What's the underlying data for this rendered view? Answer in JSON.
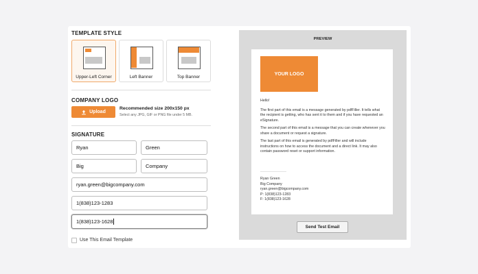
{
  "template_style": {
    "title": "TEMPLATE STYLE",
    "options": [
      {
        "label": "Upper-Left Corner",
        "selected": true
      },
      {
        "label": "Left Banner",
        "selected": false
      },
      {
        "label": "Top Banner",
        "selected": false
      }
    ]
  },
  "company_logo": {
    "title": "COMPANY LOGO",
    "upload_label": "Upload",
    "size_text": "Recommended size 200x150 px",
    "hint_text": "Select any JPG, GIF or PNG file under 5 MB."
  },
  "signature": {
    "title": "SIGNATURE",
    "first_name": "Ryan",
    "last_name": "Green",
    "title_field": "Big",
    "company": "Company",
    "email": "ryan.green@bigcompany.com",
    "phone": "1(838)123-1283",
    "fax": "1(838)123-1628"
  },
  "use_template": {
    "label": "Use This Email Template",
    "checked": false
  },
  "preview": {
    "title": "PREVIEW",
    "logo_text": "YOUR LOGO",
    "greeting": "Hello!",
    "para1": "The first part of this email is a message generated by pdfFiller. It tells what the recipient is getting, who has sent it to them and if you have requested an eSignature.",
    "para2": "The second part of this email is a message that you can create whenever you share a document or request a signature.",
    "para3": "The last part of this email is generated by pdfFiller and will include instructions on how to access the document and a direct link. It may also contain password reset or support information.",
    "sig_name": "Ryan Green",
    "sig_company": "Big Company",
    "sig_email": "ryan.green@bigcompany.com",
    "sig_phone": "P: 1(838)123-1283",
    "sig_fax": "F: 1(838)123-1628",
    "send_label": "Send Test Email"
  },
  "colors": {
    "accent": "#ee8a35",
    "preview_bg": "#dadada"
  }
}
